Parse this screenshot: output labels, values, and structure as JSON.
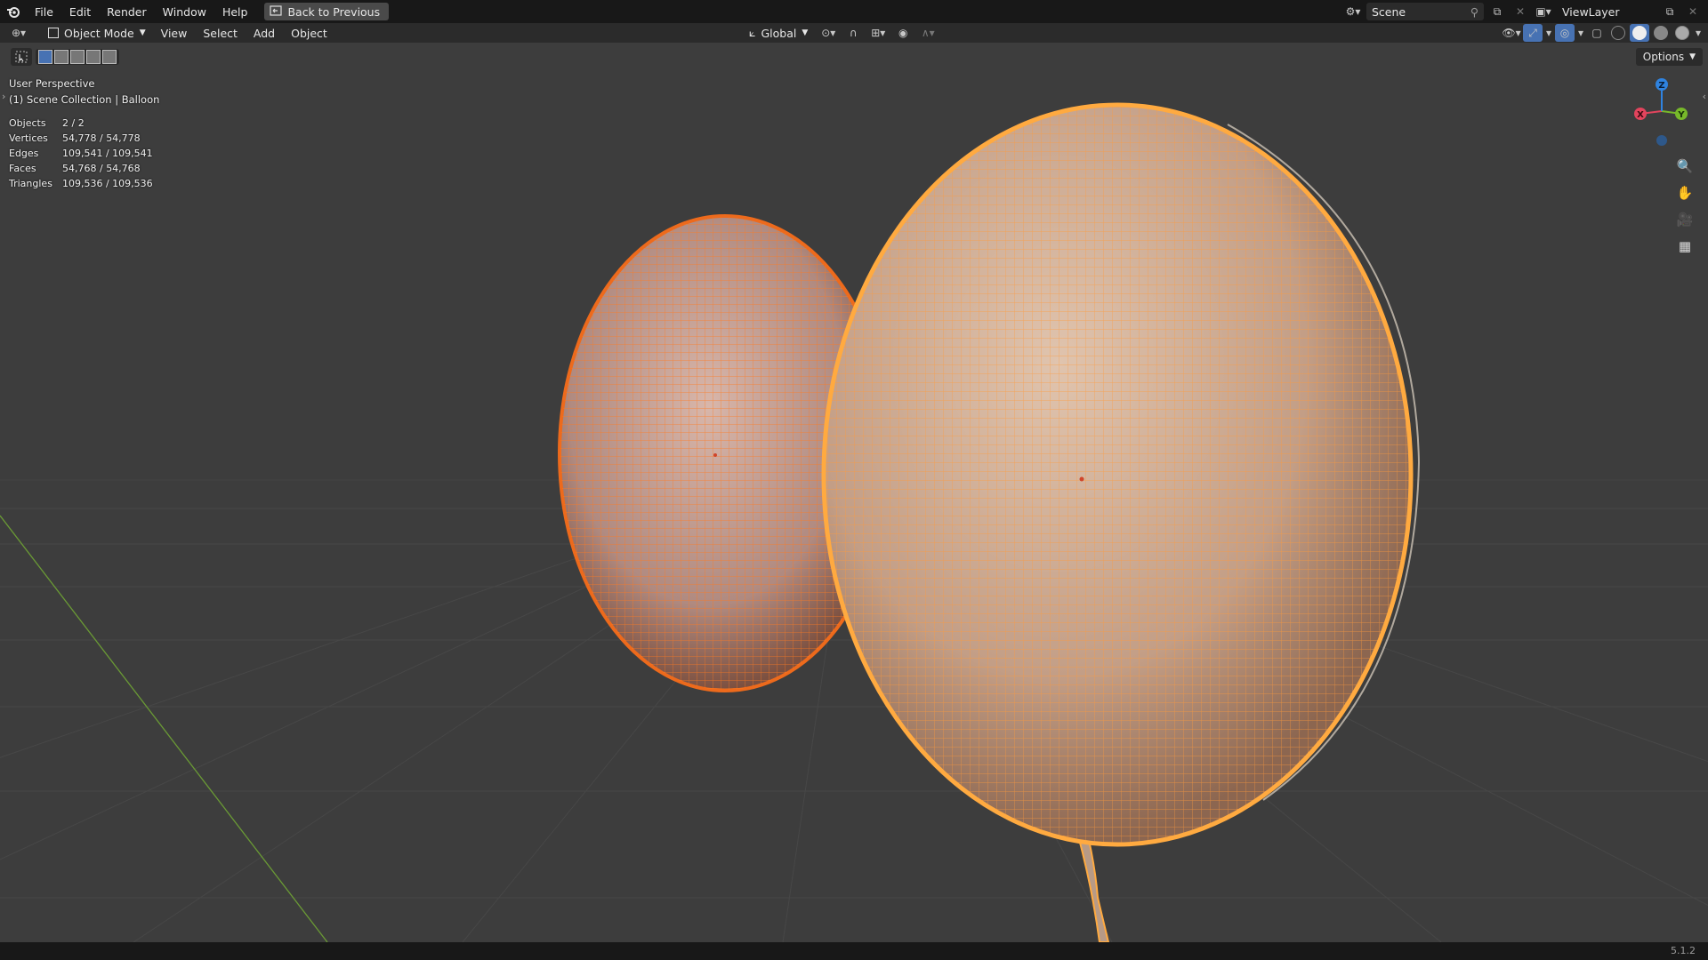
{
  "topbar": {
    "menus": [
      "File",
      "Edit",
      "Render",
      "Window",
      "Help"
    ],
    "back_label": "Back to Previous",
    "scene_name": "Scene",
    "view_layer": "ViewLayer"
  },
  "header": {
    "mode": "Object Mode",
    "menus": [
      "View",
      "Select",
      "Add",
      "Object"
    ],
    "orientation": "Global",
    "options_label": "Options"
  },
  "viewport": {
    "perspective": "User Perspective",
    "collection": "(1) Scene Collection | Balloon"
  },
  "stats": [
    {
      "label": "Objects",
      "value": "2 / 2"
    },
    {
      "label": "Vertices",
      "value": "54,778 / 54,778"
    },
    {
      "label": "Edges",
      "value": "109,541 / 109,541"
    },
    {
      "label": "Faces",
      "value": "54,768 / 54,768"
    },
    {
      "label": "Triangles",
      "value": "109,536 / 109,536"
    }
  ],
  "gizmo": {
    "x_label": "X",
    "y_label": "Y",
    "z_label": "Z",
    "x_color": "#e2445d",
    "y_color": "#77b82a",
    "z_color": "#2f83e0"
  },
  "colors": {
    "selected_active": "#ffaa40",
    "selected": "#ed6a1c",
    "grid_line": "#474747",
    "y_axis": "#6a9a35"
  },
  "status": {
    "version": "5.1.2"
  }
}
